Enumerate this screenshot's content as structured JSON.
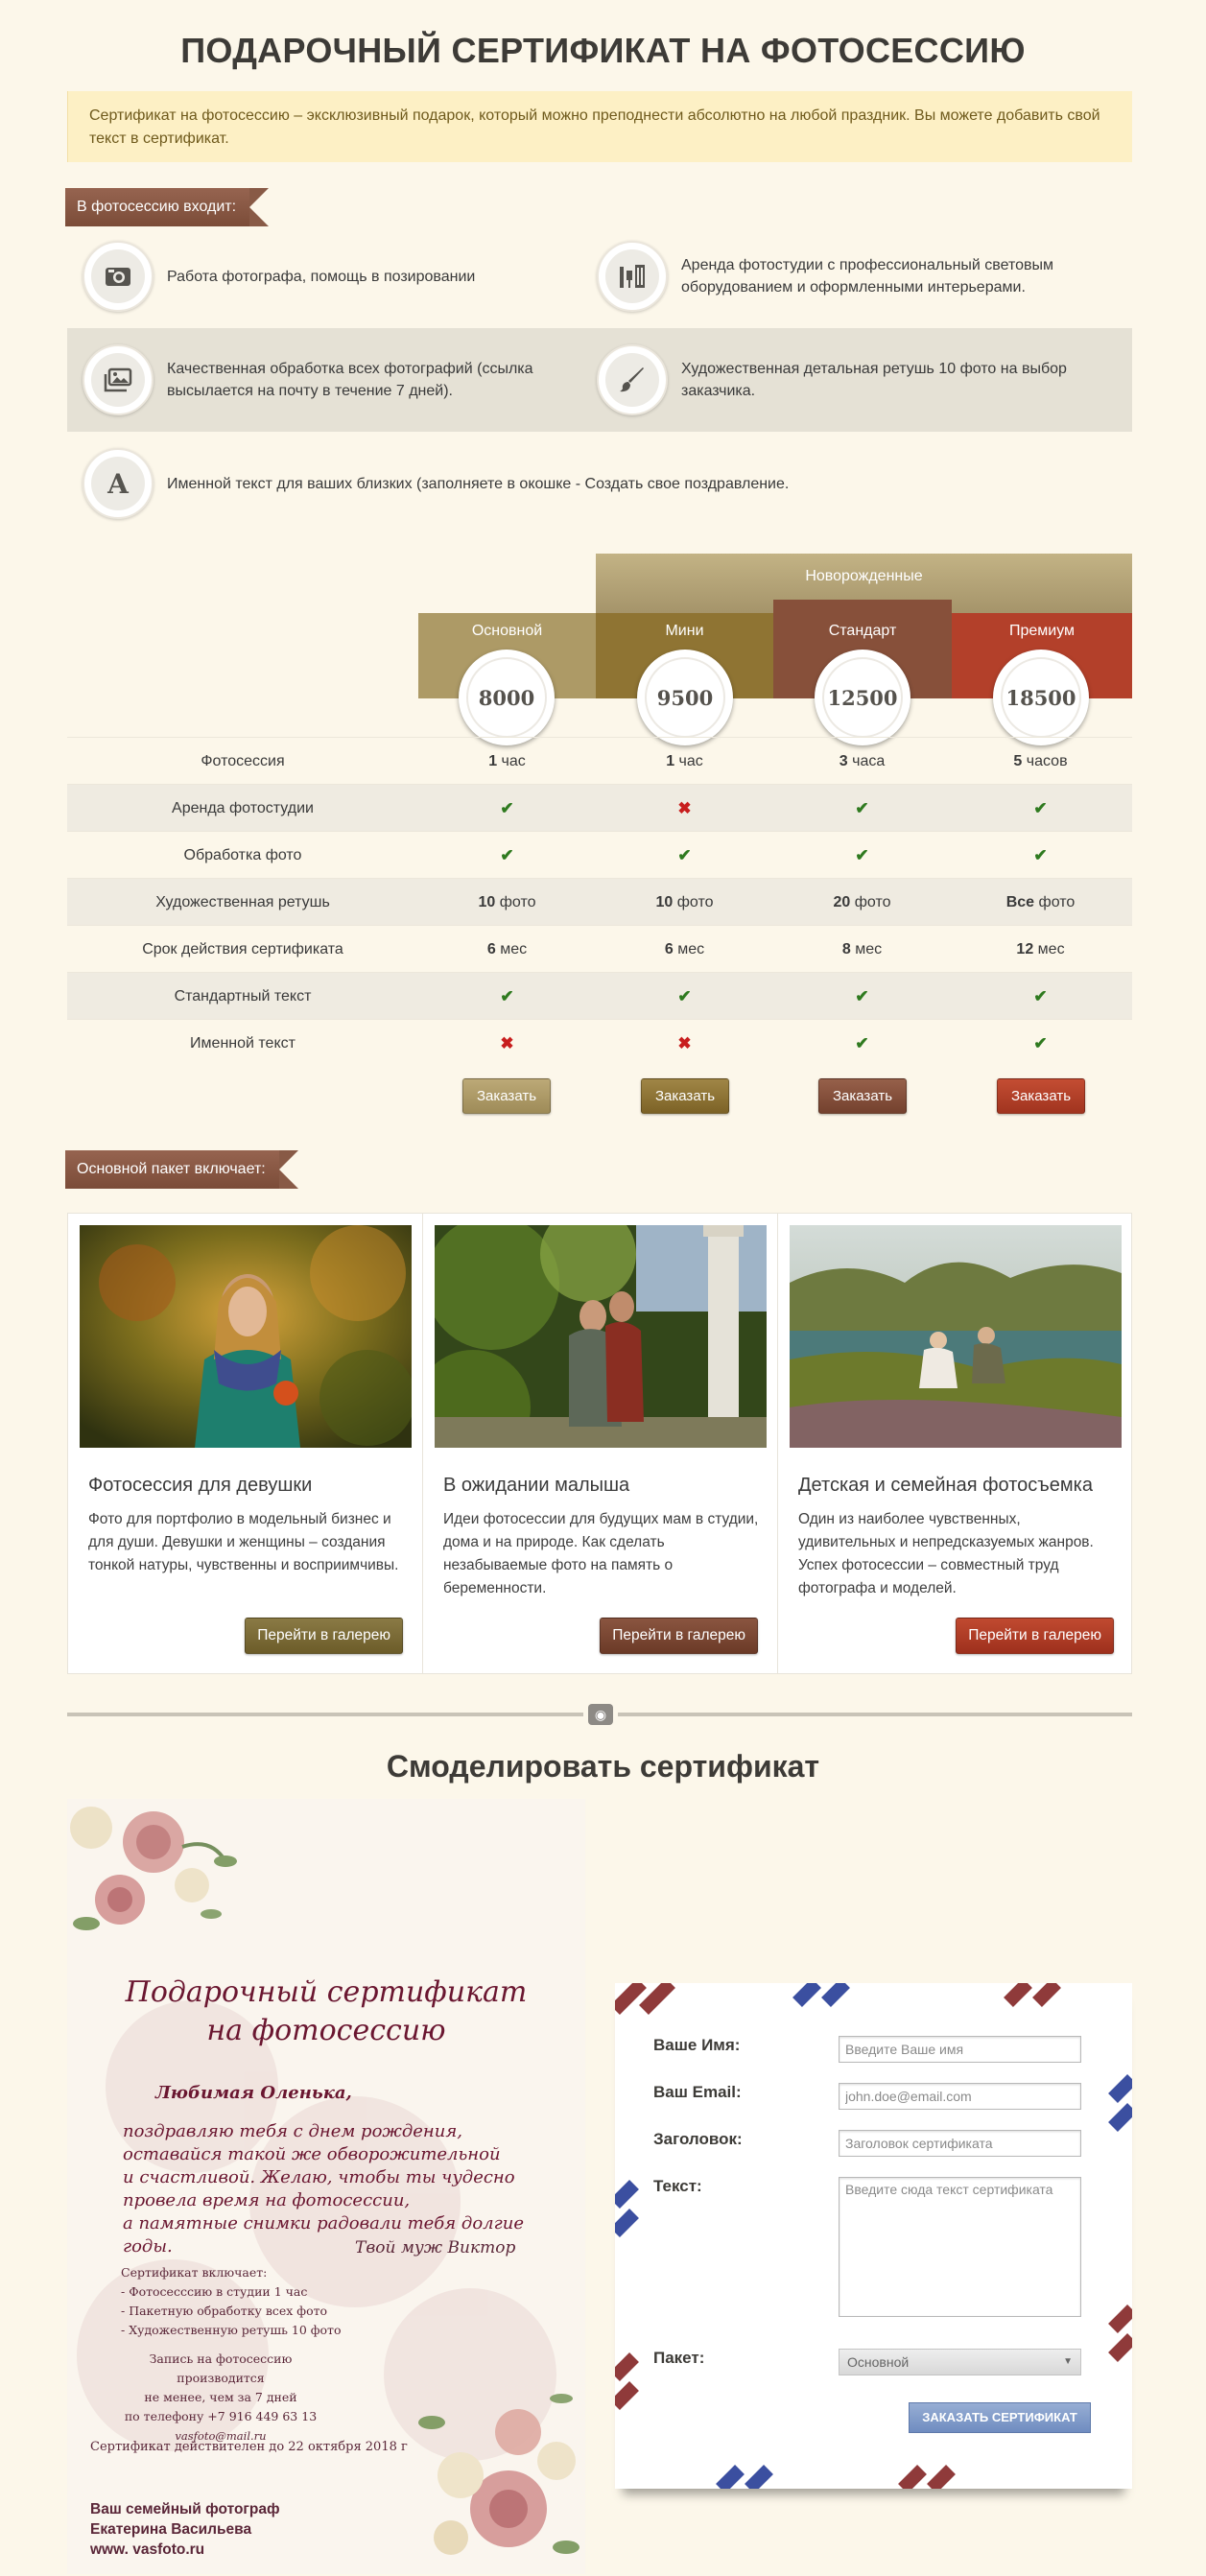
{
  "page_title": "ПОДАРОЧНЫЙ СЕРТИФИКАТ НА ФОТОСЕССИЮ",
  "intro": "Сертификат на фотосессию – эксклюзивный подарок, который можно преподнести абсолютно на любой праздник. Вы можете добавить свой текст в сертификат.",
  "includes": {
    "ribbon": "В фотосессию входит:",
    "items": [
      {
        "icon": "camera-icon",
        "text": "Работа фотографа, помощь в позировании"
      },
      {
        "icon": "studio-icon",
        "text": "Аренда фотостудии с профессиональный световым оборудованием и оформленными интерьерами."
      },
      {
        "icon": "photos-icon",
        "text": "Качественная обработка всех фотографий (ссылка высылается на почту в течение 7 дней)."
      },
      {
        "icon": "brush-icon",
        "text": "Художественная детальная ретушь 10 фото на выбор заказчика."
      },
      {
        "icon": "letter-a-icon",
        "text": "Именной текст для ваших близких (заполняете в окошке - Создать свое поздравление."
      }
    ]
  },
  "pricing": {
    "group_label": "Новорожденные",
    "packages": [
      {
        "name": "Основной",
        "price": "8000",
        "color": "#ad9a66"
      },
      {
        "name": "Мини",
        "price": "9500",
        "color": "#8f7433"
      },
      {
        "name": "Стандарт",
        "price": "12500",
        "color": "#87503a"
      },
      {
        "name": "Премиум",
        "price": "18500",
        "color": "#b3402a"
      }
    ],
    "rows": [
      {
        "label": "Фотосессия",
        "cells": [
          {
            "b": "1",
            "t": " час"
          },
          {
            "b": "1",
            "t": " час"
          },
          {
            "b": "3",
            "t": " часа"
          },
          {
            "b": "5",
            "t": " часов"
          }
        ]
      },
      {
        "label": "Аренда фотостудии",
        "cells": [
          {
            "mark": "yes"
          },
          {
            "mark": "no"
          },
          {
            "mark": "yes"
          },
          {
            "mark": "yes"
          }
        ]
      },
      {
        "label": "Обработка фото",
        "cells": [
          {
            "mark": "yes"
          },
          {
            "mark": "yes"
          },
          {
            "mark": "yes"
          },
          {
            "mark": "yes"
          }
        ]
      },
      {
        "label": "Художественная ретушь",
        "cells": [
          {
            "b": "10",
            "t": " фото"
          },
          {
            "b": "10",
            "t": " фото"
          },
          {
            "b": "20",
            "t": " фото"
          },
          {
            "b": "Все",
            "t": " фото"
          }
        ]
      },
      {
        "label": "Срок действия сертификата",
        "cells": [
          {
            "b": "6",
            "t": " мес"
          },
          {
            "b": "6",
            "t": " мес"
          },
          {
            "b": "8",
            "t": " мес"
          },
          {
            "b": "12",
            "t": " мес"
          }
        ]
      },
      {
        "label": "Стандартный текст",
        "cells": [
          {
            "mark": "yes"
          },
          {
            "mark": "yes"
          },
          {
            "mark": "yes"
          },
          {
            "mark": "yes"
          }
        ]
      },
      {
        "label": "Именной текст",
        "cells": [
          {
            "mark": "no"
          },
          {
            "mark": "no"
          },
          {
            "mark": "yes"
          },
          {
            "mark": "yes"
          }
        ]
      }
    ],
    "order_label": "Заказать",
    "yes_glyph": "✔",
    "no_glyph": "✖"
  },
  "package_section": {
    "ribbon": "Основной пакет включает:",
    "cards": [
      {
        "title": "Фотосессия для девушки",
        "text": "Фото для портфолио в модельный бизнес и для души. Девушки и женщины – создания тонкой натуры, чувственны и восприимчивы.",
        "button": "Перейти в галерею",
        "button_color": "#7a6a35"
      },
      {
        "title": "В ожидании малыша",
        "text": "Идеи фотосессии для будущих мам в студии, дома и на природе. Как сделать незабываемые фото на память о беременности.",
        "button": "Перейти в галерею",
        "button_color": "#7b4733"
      },
      {
        "title": "Детская и семейная фотосъемка",
        "text": "Один из наиболее чувственных, удивительных и непредсказуемых жанров. Успех фотосессии – совместный труд фотографа и моделей.",
        "button": "Перейти в галерею",
        "button_color": "#b03a24"
      }
    ]
  },
  "model_title": "Смоделировать сертификат",
  "certificate": {
    "title_line1": "Подарочный сертификат",
    "title_line2": "на фотосессию",
    "to": "Любимая Оленька,",
    "body": [
      "поздравляю тебя с днем рождения,",
      "оставайся такой же обворожительной",
      "и счастливой. Желаю, чтобы ты чудесно",
      "провела время на фотосессии,",
      "а памятные снимки радовали тебя долгие годы."
    ],
    "signature": "Твой муж Виктор",
    "includes_head": "Сертификат включает:",
    "includes": [
      "- Фотосесссию в студии 1 час",
      "- Пакетную обработку всех фото",
      "- Художественную ретушь 10 фото"
    ],
    "note": [
      "Запись на фотосессию производится",
      "не менее, чем за 7 дней",
      "по телефону +7 916 449 63 13",
      "vasfoto@mail.ru"
    ],
    "valid": "Сертификат действителен до 22 октября 2018 г",
    "photographer": [
      "Ваш семейный фотограф",
      "Екатерина Васильева",
      "www. vasfoto.ru"
    ]
  },
  "form": {
    "name_label": "Ваше Имя:",
    "name_placeholder": "Введите Ваше имя",
    "email_label": "Ваш Email:",
    "email_placeholder": "john.doe@email.com",
    "subject_label": "Заголовок:",
    "subject_placeholder": "Заголовок сертификата",
    "text_label": "Текст:",
    "text_placeholder": "Введите сюда текст сертификата",
    "package_label": "Пакет:",
    "package_value": "Основной",
    "submit": "ЗАКАЗАТЬ СЕРТИФИКАТ"
  }
}
